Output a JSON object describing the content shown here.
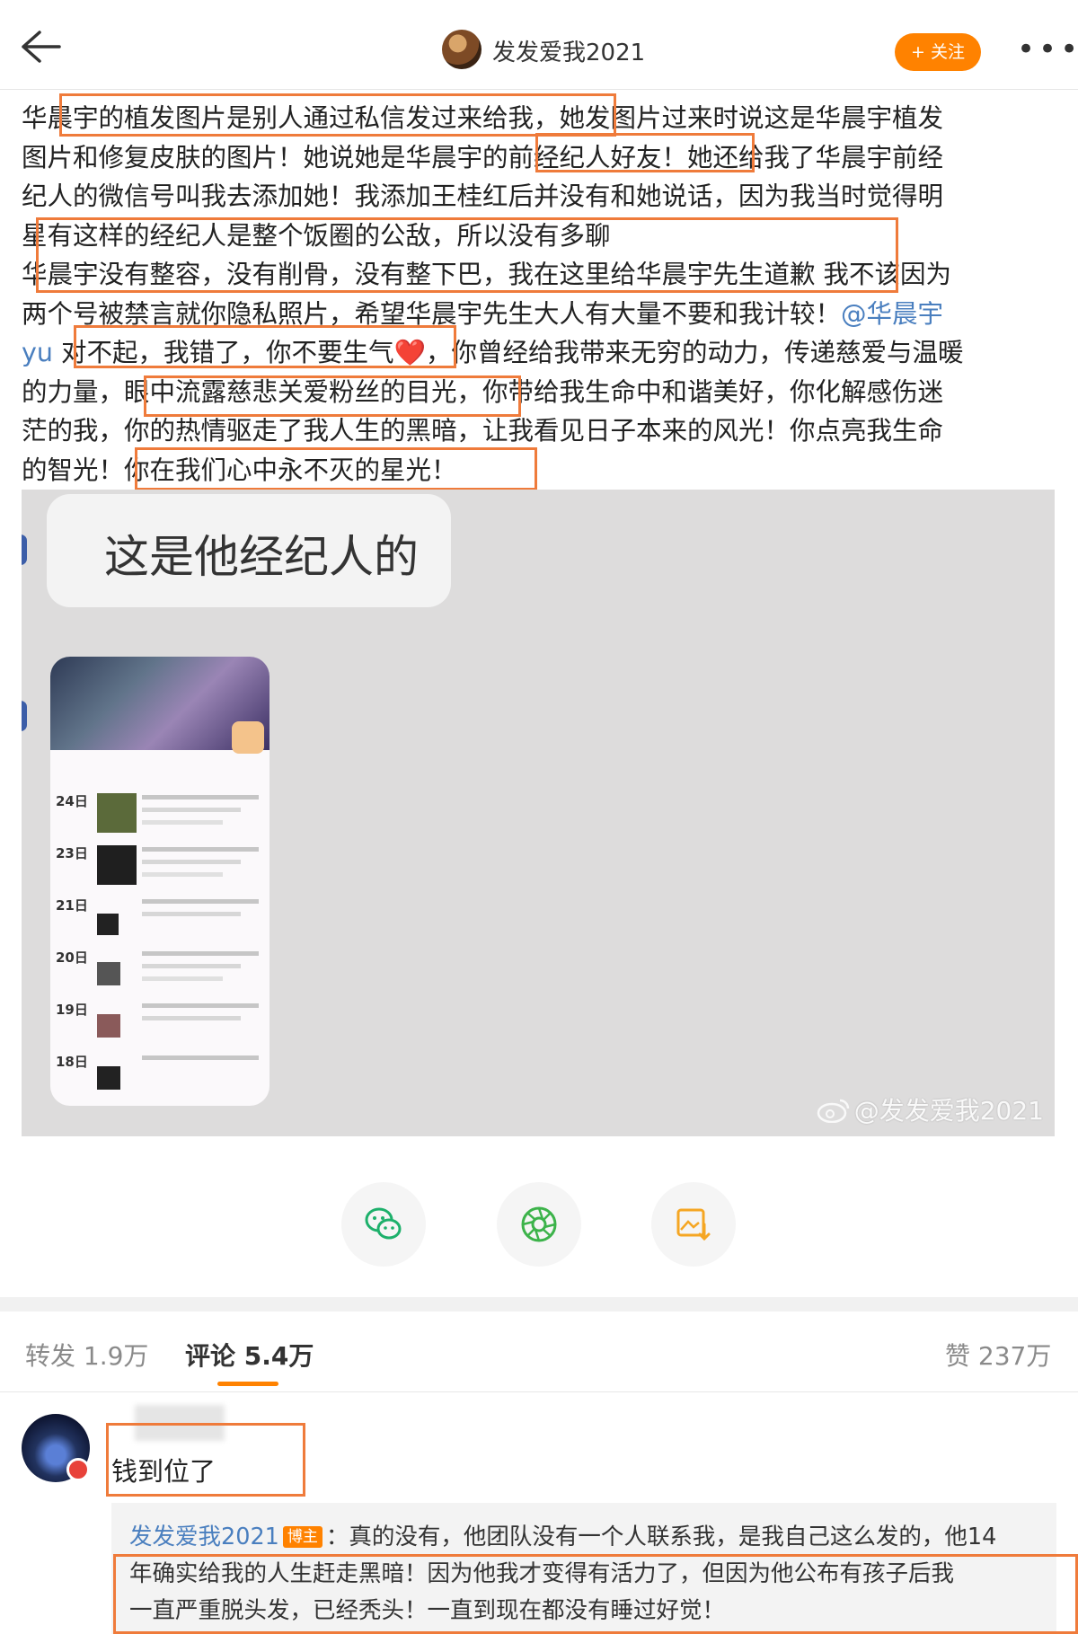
{
  "header": {
    "title": "发发爱我2021",
    "follow_label": "+ 关注"
  },
  "post": {
    "text_before_mention": "华晨宇的植发图片是别人通过私信发过来给我，她发图片过来时说这是华晨宇植发\n图片和修复皮肤的图片！她说她是华晨宇的前经纪人好友！她还给我了华晨宇前经\n纪人的微信号叫我去添加她！我添加王桂红后并没有和她说话，因为我当时觉得明\n星有这样的经纪人是整个饭圈的公敌，所以没有多聊\n华晨宇没有整容，没有削骨，没有整下巴，我在这里给华晨宇先生道歉  我不该因为\n两个号被禁言就你隐私照片，希望华晨宇先生大人有大量不要和我计较！",
    "mention": "@华晨宇\nyu",
    "text_after_mention": " 对不起，我错了，你不要生气❤️，你曾经给我带来无穷的动力，传递慈爱与温暖\n的力量，眼中流露慈悲关爱粉丝的目光，你带给我生命中和谐美好，你化解感伤迷\n茫的我，你的热情驱走了我人生的黑暗，让我看见日子本来的风光！你点亮我生命\n的智光！你在我们心中永不灭的星光！"
  },
  "image": {
    "bubble_text": "这是他经纪人的",
    "phone_rows": [
      {
        "day": "24日"
      },
      {
        "day": "23日"
      },
      {
        "day": "21日"
      },
      {
        "day": "20日"
      },
      {
        "day": "19日"
      },
      {
        "day": "18日"
      }
    ],
    "watermark": "@发发爱我2021"
  },
  "tabs": {
    "repost": "转发 1.9万",
    "comments": "评论 5.4万",
    "likes": "赞 237万"
  },
  "comment": {
    "text": "钱到位了",
    "reply_name": "发发爱我2021",
    "reply_tag": "博主",
    "reply_text": "：真的没有，他团队没有一个人联系我，是我自己这么发的，他14\n年确实给我的人生赶走黑暗！因为他我才变得有活力了，但因为他公布有孩子后我\n一直严重脱头发，已经秃头！一直到现在都没有睡过好觉！"
  },
  "colors": {
    "accent": "#ff8200",
    "highlight_box": "#ef7b3b",
    "link": "#4a7fbf"
  },
  "icons": [
    "back-arrow-icon",
    "more-icon",
    "wechat-icon",
    "moments-icon",
    "save-image-icon",
    "weibo-icon"
  ]
}
